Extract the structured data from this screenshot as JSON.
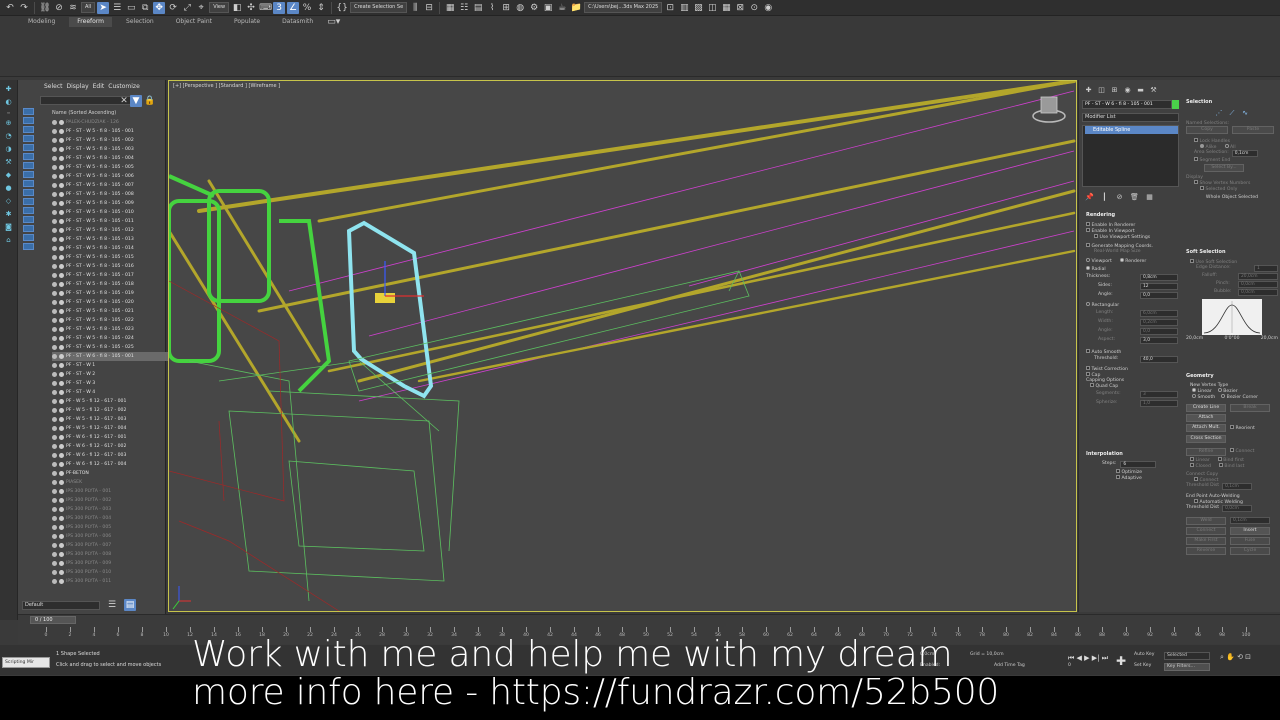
{
  "toolbar": {
    "filter_dropdown": "All",
    "view_dropdown": "View",
    "selection_set": "Create Selection Se",
    "path": "C:\\Users\\bej...3ds Max 2025"
  },
  "ribbon": {
    "tabs": [
      "Modeling",
      "Freeform",
      "Selection",
      "Object Paint",
      "Populate",
      "Datasmith"
    ],
    "active_tab": "Freeform"
  },
  "explorer": {
    "menu": [
      "Select",
      "Display",
      "Edit",
      "Customize"
    ],
    "header": "Name (Sorted Ascending)",
    "items": [
      {
        "label": "PALEK-CHUDZIAK - 126",
        "dim": true
      },
      {
        "label": "PF - ST - W 5 - fi 8 - 105 - 001"
      },
      {
        "label": "PF - ST - W 5 - fi 8 - 105 - 002"
      },
      {
        "label": "PF - ST - W 5 - fi 8 - 105 - 003"
      },
      {
        "label": "PF - ST - W 5 - fi 8 - 105 - 004"
      },
      {
        "label": "PF - ST - W 5 - fi 8 - 105 - 005"
      },
      {
        "label": "PF - ST - W 5 - fi 8 - 105 - 006"
      },
      {
        "label": "PF - ST - W 5 - fi 8 - 105 - 007"
      },
      {
        "label": "PF - ST - W 5 - fi 8 - 105 - 008"
      },
      {
        "label": "PF - ST - W 5 - fi 8 - 105 - 009"
      },
      {
        "label": "PF - ST - W 5 - fi 8 - 105 - 010"
      },
      {
        "label": "PF - ST - W 5 - fi 8 - 105 - 011"
      },
      {
        "label": "PF - ST - W 5 - fi 8 - 105 - 012"
      },
      {
        "label": "PF - ST - W 5 - fi 8 - 105 - 013"
      },
      {
        "label": "PF - ST - W 5 - fi 8 - 105 - 014"
      },
      {
        "label": "PF - ST - W 5 - fi 8 - 105 - 015"
      },
      {
        "label": "PF - ST - W 5 - fi 8 - 105 - 016"
      },
      {
        "label": "PF - ST - W 5 - fi 8 - 105 - 017"
      },
      {
        "label": "PF - ST - W 5 - fi 8 - 105 - 018"
      },
      {
        "label": "PF - ST - W 5 - fi 8 - 105 - 019"
      },
      {
        "label": "PF - ST - W 5 - fi 8 - 105 - 020"
      },
      {
        "label": "PF - ST - W 5 - fi 8 - 105 - 021"
      },
      {
        "label": "PF - ST - W 5 - fi 8 - 105 - 022"
      },
      {
        "label": "PF - ST - W 5 - fi 8 - 105 - 023"
      },
      {
        "label": "PF - ST - W 5 - fi 8 - 105 - 024"
      },
      {
        "label": "PF - ST - W 5 - fi 8 - 105 - 025"
      },
      {
        "label": "PF - ST - W 6 - fi 8 - 105 - 001",
        "selected": true
      },
      {
        "label": "PF - ST - W 1"
      },
      {
        "label": "PF - ST - W 2"
      },
      {
        "label": "PF - ST - W 3"
      },
      {
        "label": "PF - ST - W 4"
      },
      {
        "label": "PF - W 5 - fi 12 - 617 - 001"
      },
      {
        "label": "PF - W 5 - fi 12 - 617 - 002"
      },
      {
        "label": "PF - W 5 - fi 12 - 617 - 003"
      },
      {
        "label": "PF - W 5 - fi 12 - 617 - 004"
      },
      {
        "label": "PF - W 6 - fi 12 - 617 - 001"
      },
      {
        "label": "PF - W 6 - fi 12 - 617 - 002"
      },
      {
        "label": "PF - W 6 - fi 12 - 617 - 003"
      },
      {
        "label": "PF - W 6 - fi 12 - 617 - 004"
      },
      {
        "label": "PF-BETON"
      },
      {
        "label": "PIASEK",
        "dim": true
      },
      {
        "label": "IPS 300 PLYTA - 001",
        "dim": true
      },
      {
        "label": "IPS 300 PLYTA - 002",
        "dim": true
      },
      {
        "label": "IPS 300 PLYTA - 003",
        "dim": true
      },
      {
        "label": "IPS 300 PLYTA - 004",
        "dim": true
      },
      {
        "label": "IPS 300 PLYTA - 005",
        "dim": true
      },
      {
        "label": "IPS 300 PLYTA - 006",
        "dim": true
      },
      {
        "label": "IPS 300 PLYTA - 007",
        "dim": true
      },
      {
        "label": "IPS 300 PLYTA - 008",
        "dim": true
      },
      {
        "label": "IPS 300 PLYTA - 009",
        "dim": true
      },
      {
        "label": "IPS 300 PLYTA - 010",
        "dim": true
      },
      {
        "label": "IPS 300 PLYTA - 011",
        "dim": true
      }
    ],
    "layer": "Default"
  },
  "viewport": {
    "label": "[+] [Perspective ] [Standard ] [Wireframe ]"
  },
  "command_panel": {
    "object_name": "PF - ST - W 6 - fi 8 - 105 - 001",
    "modifier_list": "Modifier List",
    "stack_item": "Editable Spline",
    "rendering": {
      "title": "Rendering",
      "enable_renderer": "Enable In Renderer",
      "enable_viewport": "Enable In Viewport",
      "use_viewport": "Use Viewport Settings",
      "gen_mapping": "Generate Mapping Coords.",
      "real_world": "Real-World Map Size",
      "viewport_radio": "Viewport",
      "renderer_radio": "Renderer",
      "radial": "Radial",
      "thickness_label": "Thickness:",
      "thickness": "0,8cm",
      "sides_label": "Sides:",
      "sides": "12",
      "angle_label": "Angle:",
      "angle": "0,0",
      "rectangular": "Rectangular",
      "length_label": "Length:",
      "length": "6,0cm",
      "width_label": "Width:",
      "width": "0,2cm",
      "angle2_label": "Angle:",
      "angle2": "0,0",
      "aspect_label": "Aspect:",
      "aspect": "3,0",
      "auto_smooth": "Auto Smooth",
      "threshold_label": "Threshold:",
      "threshold": "40,0",
      "twist": "Twist Correction",
      "cap": "Cap",
      "capping": "Capping Options",
      "quad_cap": "Quad Cap",
      "segments_label": "Segments:",
      "segments": "3",
      "spherize_label": "Spherize:",
      "spherize": "1,0"
    },
    "interpolation": {
      "title": "Interpolation",
      "steps_label": "Steps:",
      "steps": "6",
      "optimize": "Optimize",
      "adaptive": "Adaptive"
    },
    "selection": {
      "title": "Selection",
      "named": "Named Selections:",
      "copy": "Copy",
      "paste": "Paste",
      "lock": "Lock Handles",
      "alike": "Alike",
      "all": "All",
      "area": "Area Selection:",
      "area_val": "0,1cm",
      "segment_end": "Segment End",
      "select_by": "Select By...",
      "display": "Display",
      "show_vertex": "Show Vertex Numbers",
      "selected_only": "Selected Only",
      "whole": "Whole Object Selected"
    },
    "soft": {
      "title": "Soft Selection",
      "use": "Use Soft Selection",
      "edge": "Edge Distance:",
      "edge_val": "1",
      "falloff": "Falloff:",
      "falloff_val": "20,0cm",
      "pinch": "Pinch:",
      "pinch_val": "0,0cm",
      "bubble": "Bubble:",
      "bubble_val": "0,0cm",
      "left": "20,0cm",
      "mid": "0'0\"00",
      "right": "20,0cm"
    },
    "geometry": {
      "title": "Geometry",
      "new_vertex": "New Vertex Type",
      "linear": "Linear",
      "bezier": "Bezier",
      "smooth": "Smooth",
      "bezier_corner": "Bezier Corner",
      "create_line": "Create Line",
      "break": "Break",
      "attach": "Attach",
      "attach_mult": "Attach Mult.",
      "reorient": "Reorient",
      "cross_section": "Cross Section",
      "refine": "Refine",
      "connect": "Connect",
      "linear2": "Linear",
      "bind_first": "Bind first",
      "closed": "Closed",
      "bind_last": "Bind last",
      "connect_copy": "Connect Copy",
      "connect2": "Connect",
      "threshold_dist": "Threshold Dist",
      "threshold_val": "0,1cm",
      "end_point": "End Point Auto-Welding",
      "auto_weld": "Automatic Welding",
      "threshold_dist2": "Threshold Dist",
      "threshold_val2": "0,0cm",
      "weld": "Weld",
      "weld_val": "0,1cm",
      "connect3": "Connect",
      "insert": "Insert",
      "make_first": "Make First",
      "fuse": "Fuse",
      "reverse": "Reverse",
      "cycle": "Cycle"
    }
  },
  "timeline": {
    "slider": "0 / 100",
    "ticks": [
      "0",
      "2",
      "4",
      "6",
      "8",
      "10",
      "12",
      "14",
      "16",
      "18",
      "20",
      "22",
      "24",
      "26",
      "28",
      "30",
      "32",
      "34",
      "36",
      "38",
      "40",
      "42",
      "44",
      "46",
      "48",
      "50",
      "52",
      "54",
      "56",
      "58",
      "60",
      "62",
      "64",
      "66",
      "68",
      "70",
      "72",
      "74",
      "76",
      "78",
      "80",
      "82",
      "84",
      "86",
      "88",
      "90",
      "92",
      "94",
      "96",
      "98",
      "100"
    ]
  },
  "status": {
    "script": "Scripting Mir",
    "line1": "1 Shape Selected",
    "line2": "Click and drag to select and move objects",
    "z": "0,0cm",
    "grid": "Grid = 10,0cm",
    "enabled": "Enabled:",
    "add_time_tag": "Add Time Tag",
    "auto_key": "Auto Key",
    "selected": "Selected",
    "set_key": "Set Key",
    "key_filters": "Key Filters...",
    "frame": "0"
  },
  "caption": {
    "line1": "Work with me and help me with my dream",
    "line2": "more info here - https://fundrazr.com/52b500"
  },
  "colors": {
    "accent": "#5b87c6",
    "viewport_border": "#c7c44b",
    "rebar_yellow": "#b3a62b",
    "stirrup_green": "#45d33f",
    "selected_cyan": "#8fe4ef",
    "magenta": "#d040d0"
  }
}
